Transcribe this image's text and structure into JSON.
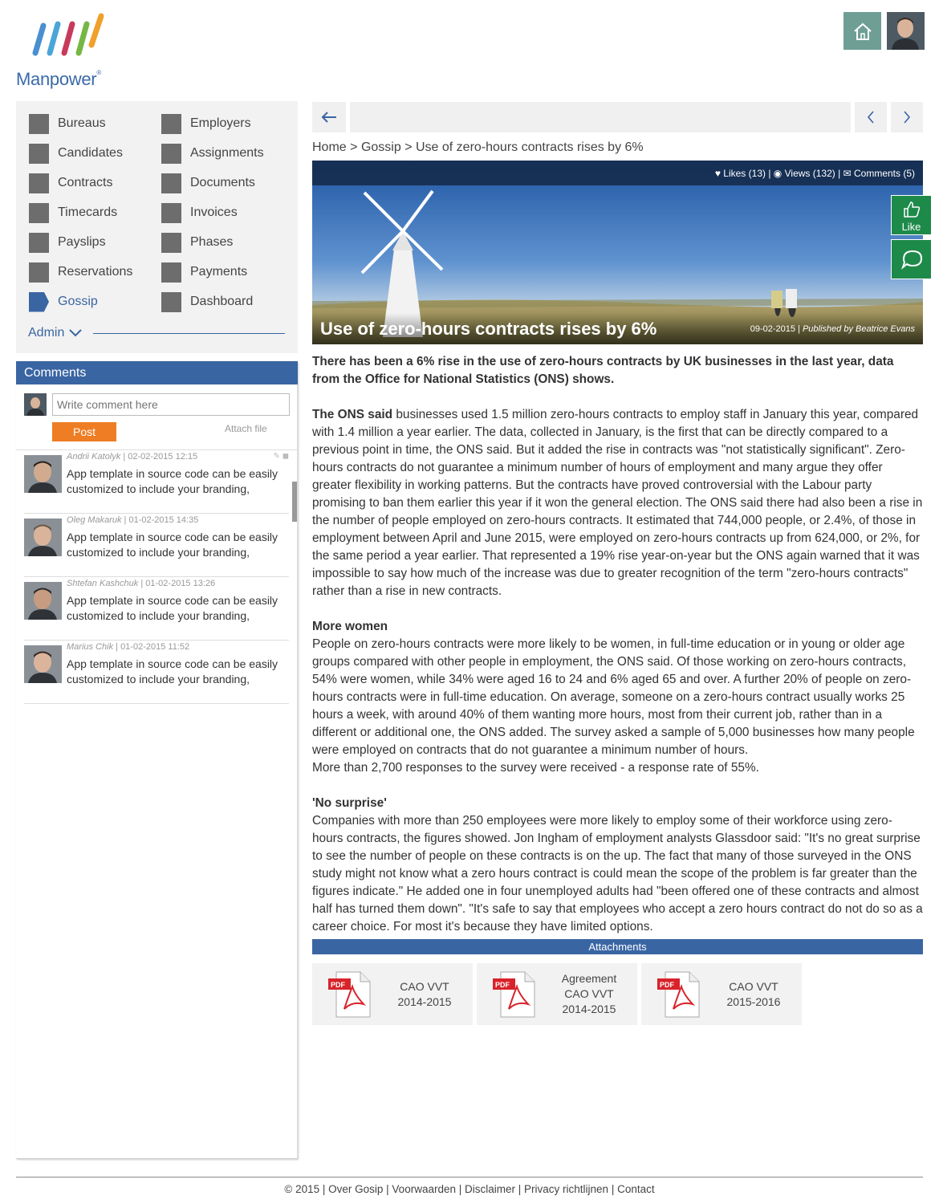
{
  "brand": {
    "name": "Manpower",
    "mark": "®"
  },
  "nav": {
    "left": [
      {
        "label": "Bureaus"
      },
      {
        "label": "Candidates"
      },
      {
        "label": "Contracts"
      },
      {
        "label": "Timecards"
      },
      {
        "label": "Payslips"
      },
      {
        "label": "Reservations"
      },
      {
        "label": "Gossip",
        "active": true
      }
    ],
    "right": [
      {
        "label": "Employers"
      },
      {
        "label": "Assignments"
      },
      {
        "label": "Documents"
      },
      {
        "label": "Invoices"
      },
      {
        "label": "Phases"
      },
      {
        "label": "Payments"
      },
      {
        "label": "Dashboard"
      }
    ],
    "admin_label": "Admin"
  },
  "comments": {
    "title": "Comments",
    "input_placeholder": "Write comment here",
    "post_label": "Post",
    "attach_label": "Attach file",
    "items": [
      {
        "author": "Andrii Katolyk",
        "date": "02-02-2015 12:15",
        "text": "App template in source code can be easily customized to include your branding,"
      },
      {
        "author": "Oleg Makaruk",
        "date": "01-02-2015 14:35",
        "text": "App template in source code can be easily customized to include your branding,"
      },
      {
        "author": "Shtefan Kashchuk",
        "date": "01-02-2015 13:26",
        "text": "App template in source code can be easily customized to include your branding,"
      },
      {
        "author": "Marius Chik",
        "date": "01-02-2015 11:52",
        "text": "App template in source code can be easily customized to include your branding,"
      }
    ]
  },
  "breadcrumb": {
    "home": "Home",
    "sep": ">",
    "section": "Gossip",
    "current": "Use of zero-hours contracts rises by 6%"
  },
  "hero": {
    "likes": "Likes (13)",
    "views": "Views (132)",
    "comments": "Comments (5)",
    "divider": "|",
    "title": "Use of zero-hours contracts rises by 6%",
    "date": "09-02-2015",
    "published_by": "Published by Beatrice Evans"
  },
  "like_button": "Like",
  "article": {
    "lead": "There has been a 6% rise in the use of zero-hours contracts by UK businesses in the last year, data from the Office for National Statistics (ONS) shows.",
    "p1_bold": "The ONS said",
    "p1": " businesses used 1.5 million zero-hours contracts to employ staff in January this year, compared with 1.4 million a year earlier. The data, collected in January, is the first that can be directly compared to a previous point in time, the ONS said. But it added the rise in contracts was \"not statistically significant\". Zero-hours contracts do not guarantee a minimum number of hours of employment and many argue they offer greater flexibility in working patterns. But the contracts have proved controversial with the Labour party promising to ban them earlier this year if it won the general election. The ONS said there had also been a rise in the number of people employed on zero-hours contracts. It estimated that 744,000 people, or 2.4%, of those in employment between April and June 2015, were employed on zero-hours contracts up from 624,000, or 2%, for the same period a year earlier. That represented a 19% rise year-on-year but the ONS again warned that it was impossible to say how much of the increase was due to greater recognition of the term \"zero-hours contracts\" rather than a rise in new contracts.",
    "h2": "More women",
    "p2": "People on zero-hours contracts were more likely to be women, in full-time education or in young or older age groups compared with other people in employment, the ONS said. Of those working on zero-hours contracts, 54% were women, while 34% were aged 16 to 24 and 6% aged 65 and over. A further 20% of people on zero-hours contracts were in full-time education. On average, someone on a zero-hours contract usually works 25 hours a week, with around 40% of them wanting more hours, most from their current job, rather than in a different or additional one, the ONS added. The survey asked a sample of 5,000 businesses how many people were employed on contracts that do not guarantee a minimum number of hours.",
    "p2b": "More than 2,700 responses to the survey were received - a response rate of 55%.",
    "h3": "'No surprise'",
    "p3": "Companies with more than 250 employees were more likely to employ some of their workforce using zero-hours contracts, the figures showed. Jon Ingham of employment analysts Glassdoor said: \"It's no great surprise to see the number of people on these contracts is on the up. The fact that many of those surveyed in the ONS study might not know what a zero hours contract is could mean the scope of the problem is far greater than the figures indicate.\" He added one in four unemployed adults had \"been offered one of these contracts and almost half has turned them down\". \"It's safe to say that employees who accept a zero hours contract do not do so as a career choice. For most it's because they have limited options."
  },
  "attachments": {
    "title": "Attachments",
    "pdf_label": "PDF",
    "items": [
      {
        "lines": [
          "CAO VVT",
          "2014-2015"
        ]
      },
      {
        "lines": [
          "Agreement",
          "CAO VVT",
          "2014-2015"
        ]
      },
      {
        "lines": [
          "CAO VVT",
          "2015-2016"
        ]
      }
    ]
  },
  "footer": {
    "copyright": "© 2015",
    "links": [
      "Over Gosip",
      "Voorwaarden",
      "Disclaimer",
      "Privacy richtlijnen",
      "Contact"
    ]
  },
  "colors": {
    "primary": "#3a65a3",
    "accent": "#ee7d24",
    "like": "#1e8a4a",
    "home": "#6f9e95"
  }
}
